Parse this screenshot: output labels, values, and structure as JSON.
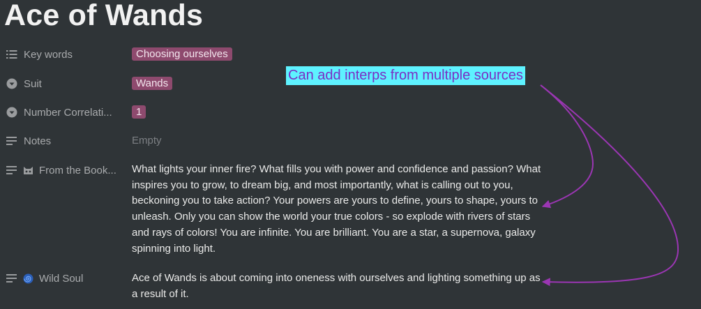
{
  "page": {
    "title": "Ace of Wands"
  },
  "properties": [
    {
      "icon": "list-icon",
      "label": "Key words",
      "tags": [
        "Choosing ourselves"
      ]
    },
    {
      "icon": "select-icon",
      "label": "Suit",
      "tags": [
        "Wands"
      ]
    },
    {
      "icon": "select-icon",
      "label": "Number Correlati...",
      "tags": [
        "1"
      ]
    },
    {
      "icon": "text-icon",
      "label": "Notes",
      "empty": "Empty"
    },
    {
      "icon": "text-icon",
      "emoji": "cat-face-icon",
      "label": "From the Book...",
      "text": "What lights your inner fire? What fills you with power and confidence and passion? What inspires you to grow, to dream big, and most importantly, what is calling out to you, beckoning you to take action? Your powers are yours to define, yours to shape, yours to unleash. Only you can show the world your true colors - so explode with rivers of stars and rays of colors! You are infinite. You are brilliant. You are a star, a supernova, galaxy spinning into light."
    },
    {
      "icon": "text-icon",
      "emoji": "spiral-icon",
      "label": "Wild Soul",
      "text": "Ace of Wands is about coming into oneness with ourselves and lighting something up as a result of it."
    }
  ],
  "annotation": {
    "text": "Can add interps from multiple sources",
    "arrow_color": "#9b36b3"
  },
  "colors": {
    "background": "#2f3437",
    "tag": "#8e4a6e",
    "annotation_bg": "#5ef2ff",
    "annotation_text": "#7a2fc4"
  }
}
